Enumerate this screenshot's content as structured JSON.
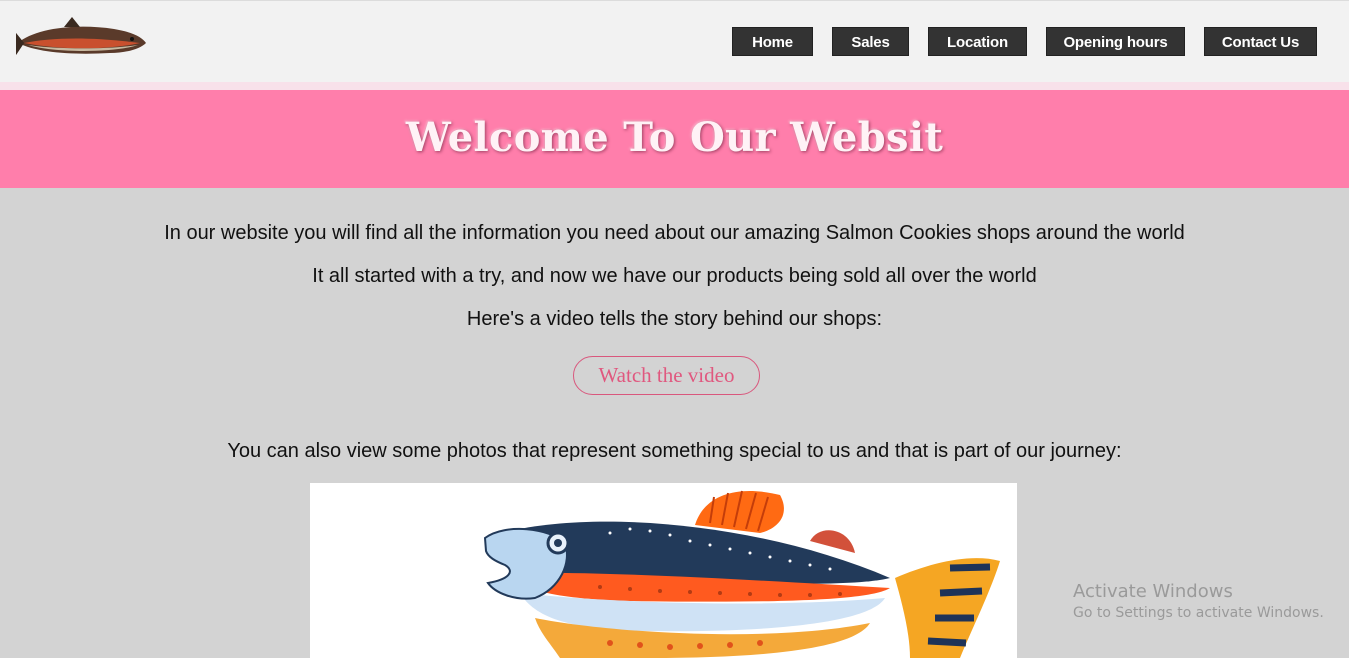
{
  "header": {
    "logo_icon": "salmon-fish-icon",
    "nav": [
      {
        "label": "Home"
      },
      {
        "label": "Sales"
      },
      {
        "label": "Location"
      },
      {
        "label": "Opening hours"
      },
      {
        "label": "Contact Us"
      }
    ]
  },
  "banner": {
    "title": "Welcome To Our Websit"
  },
  "main": {
    "paragraphs": [
      "In our website you will find all the information you need about our amazing Salmon Cookies shops around the world",
      "It all started with a try, and now we have our products being sold all over the world",
      "Here's a video tells the story behind our shops:"
    ],
    "video_button": "Watch the video",
    "photos_intro": "You can also view some photos that represent something special to us and that is part of our journey:",
    "photo_icon": "painted-salmon-illustration"
  },
  "watermark": {
    "title": "Activate Windows",
    "subtitle": "Go to Settings to activate Windows."
  },
  "colors": {
    "banner": "#ff7eab",
    "nav_button": "#333333",
    "page_background": "#d3d3d3",
    "accent": "#e0587f"
  }
}
